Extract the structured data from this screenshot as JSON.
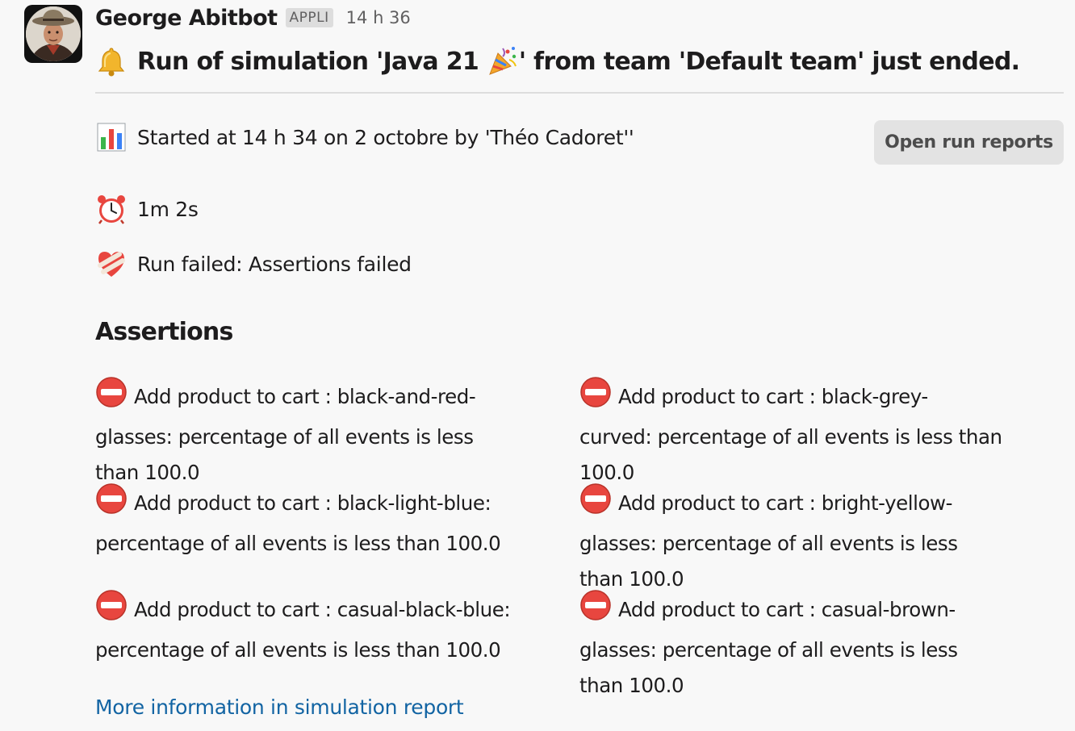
{
  "sender": {
    "name": "George Abitbot",
    "badge": "APPLI",
    "time": "14 h 36"
  },
  "headline": {
    "icon": "bell-icon",
    "text_before": "Run of simulation 'Java 21 ",
    "party_icon": "party-popper-icon",
    "text_after": "' from team 'Default team' just ended."
  },
  "details": {
    "started": {
      "icon": "bar-chart-icon",
      "text": "Started at 14 h 34 on 2 octobre by 'Théo Cadoret''"
    },
    "duration": {
      "icon": "alarm-clock-icon",
      "text": "1m 2s"
    },
    "status": {
      "icon": "mending-heart-icon",
      "text": "Run failed: Assertions failed"
    }
  },
  "open_reports_label": "Open run reports",
  "assertions": {
    "title": "Assertions",
    "icon": "no-entry-icon",
    "items": [
      {
        "lines": [
          "Add product to cart : black-and-red-",
          "glasses: percentage of all events is less",
          "than 100.0"
        ]
      },
      {
        "lines": [
          "Add product to cart : black-grey-",
          "curved: percentage of all events is less than",
          "100.0"
        ]
      },
      {
        "lines": [
          "Add product to cart : black-light-blue:",
          "percentage of all events is less than 100.0"
        ]
      },
      {
        "lines": [
          "Add product to cart : bright-yellow-",
          "glasses: percentage of all events is less",
          "than 100.0"
        ]
      },
      {
        "lines": [
          "Add product to cart : casual-black-blue:",
          "percentage of all events is less than 100.0"
        ]
      },
      {
        "lines": [
          "Add product to cart : casual-brown-",
          "glasses: percentage of all events is less",
          "than 100.0"
        ]
      }
    ]
  },
  "link_label": "More information in simulation report"
}
